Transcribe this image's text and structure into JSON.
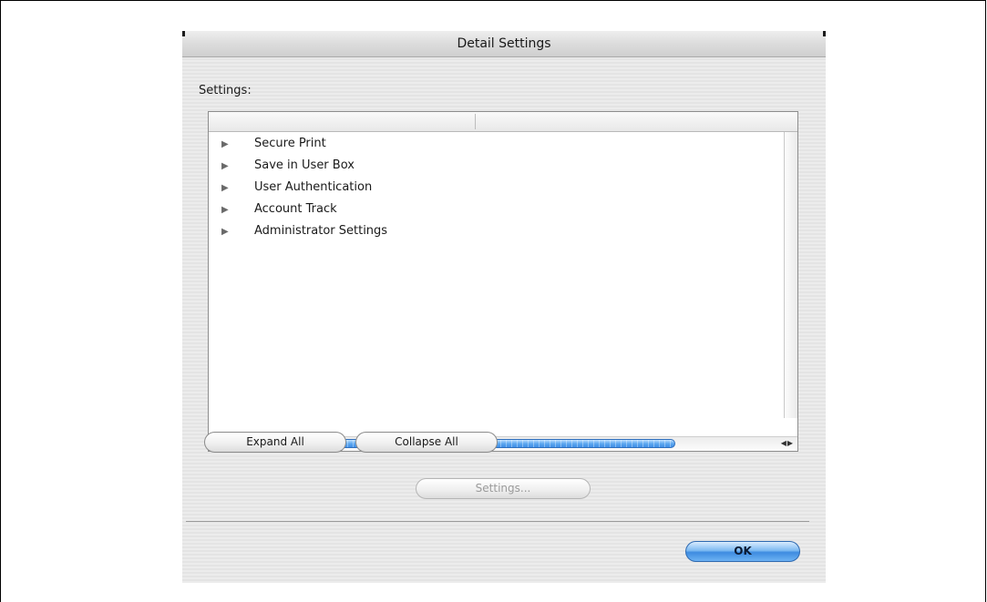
{
  "window": {
    "title": "Detail Settings"
  },
  "settings_label": "Settings:",
  "tree_items": [
    {
      "label": "Secure Print",
      "icon": "disclosure-triangle-right-icon"
    },
    {
      "label": "Save in User Box",
      "icon": "disclosure-triangle-right-icon"
    },
    {
      "label": "User Authentication",
      "icon": "disclosure-triangle-right-icon"
    },
    {
      "label": "Account Track",
      "icon": "disclosure-triangle-right-icon"
    },
    {
      "label": "Administrator Settings",
      "icon": "disclosure-triangle-right-icon"
    }
  ],
  "buttons": {
    "expand_all": "Expand All",
    "collapse_all": "Collapse All",
    "settings": "Settings...",
    "ok": "OK"
  },
  "colors": {
    "accent_blue": "#3f8ee6",
    "dialog_background": "#e8e8e8"
  }
}
